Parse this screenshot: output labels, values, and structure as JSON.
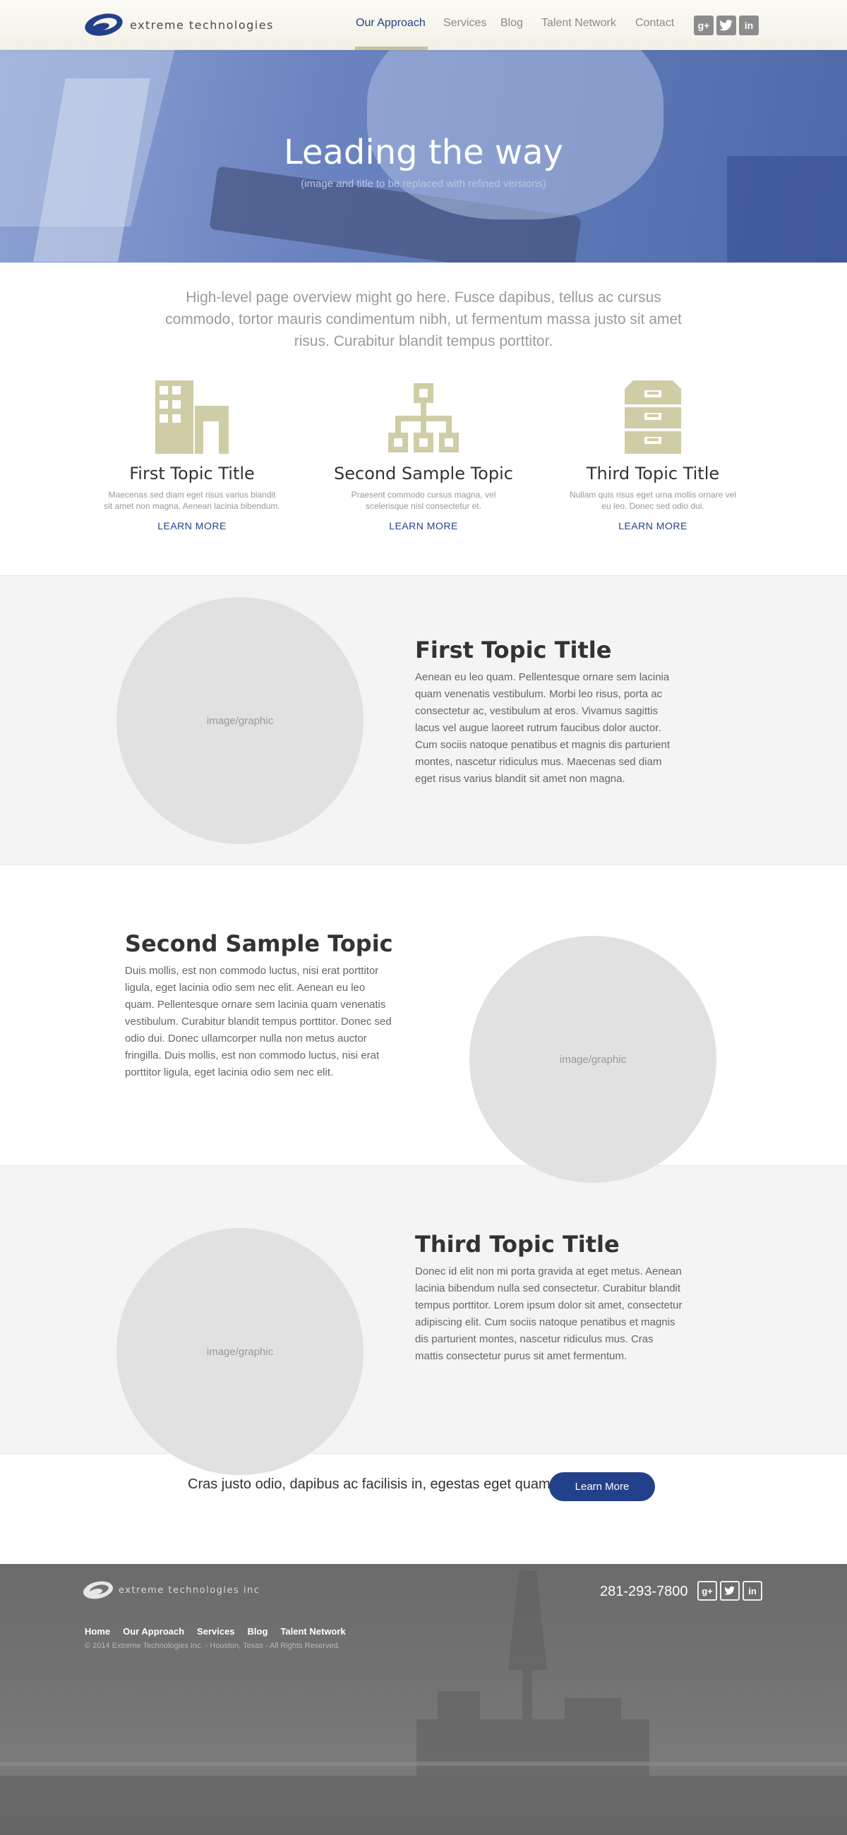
{
  "header": {
    "logo_text": "extreme technologies",
    "nav": [
      {
        "label": "Our Approach",
        "active": true
      },
      {
        "label": "Services",
        "active": false
      },
      {
        "label": "Blog",
        "active": false
      },
      {
        "label": "Talent Network",
        "active": false
      },
      {
        "label": "Contact",
        "active": false
      }
    ],
    "social": [
      {
        "icon": "google-plus-icon",
        "glyph": "g+"
      },
      {
        "icon": "twitter-icon",
        "glyph": "t"
      },
      {
        "icon": "linkedin-icon",
        "glyph": "in"
      }
    ]
  },
  "hero": {
    "title": "Leading the way",
    "subtitle": "(image and title to be replaced with refined versions)"
  },
  "overview": "High-level page overview might go here. Fusce dapibus, tellus ac cursus commodo, tortor mauris condimentum nibh, ut fermentum massa justo sit amet risus. Curabitur blandit tempus porttitor.",
  "topics": [
    {
      "icon": "building-icon",
      "title": "First Topic Title",
      "desc": "Maecenas sed diam eget risus varius blandit sit amet non magna. Aenean lacinia bibendum.",
      "link": "LEARN MORE"
    },
    {
      "icon": "org-chart-icon",
      "title": "Second Sample Topic",
      "desc": "Praesent commodo cursus magna, vel scelerisque nisl consectetur et.",
      "link": "LEARN MORE"
    },
    {
      "icon": "file-cabinet-icon",
      "title": "Third Topic Title",
      "desc": "Nullam quis risus eget urna mollis ornare vel eu leo. Donec sed odio dui.",
      "link": "LEARN MORE"
    }
  ],
  "features": [
    {
      "image_label": "image/graphic",
      "title": "First Topic Title",
      "text": "Aenean eu leo quam. Pellentesque ornare sem lacinia quam venenatis vestibulum. Morbi leo risus, porta ac consectetur ac, vestibulum at eros. Vivamus sagittis lacus vel augue laoreet rutrum faucibus dolor auctor. Cum sociis natoque penatibus et magnis dis parturient montes, nascetur ridiculus mus. Maecenas sed diam eget risus varius blandit sit amet non magna."
    },
    {
      "image_label": "image/graphic",
      "title": "Second Sample Topic",
      "text": "Duis mollis, est non commodo luctus, nisi erat porttitor ligula, eget lacinia odio sem nec elit. Aenean eu leo quam. Pellentesque ornare sem lacinia quam venenatis vestibulum. Curabitur blandit tempus porttitor. Donec sed odio dui. Donec ullamcorper nulla non metus auctor fringilla. Duis mollis, est non commodo luctus, nisi erat porttitor ligula, eget lacinia odio sem nec elit."
    },
    {
      "image_label": "image/graphic",
      "title": "Third Topic Title",
      "text": "Donec id elit non mi porta gravida at eget metus. Aenean lacinia bibendum nulla sed consectetur. Curabitur blandit tempus porttitor. Lorem ipsum dolor sit amet, consectetur adipiscing elit. Cum sociis natoque penatibus et magnis dis parturient montes, nascetur ridiculus mus. Cras mattis consectetur purus sit amet fermentum."
    }
  ],
  "cta": {
    "text": "Cras justo odio, dapibus ac facilisis in, egestas eget quam.",
    "button": "Learn More"
  },
  "footer": {
    "logo_text": "extreme technologies inc",
    "phone": "281-293-7800",
    "nav": [
      "Home",
      "Our Approach",
      "Services",
      "Blog",
      "Talent Network"
    ],
    "copyright": "© 2014 Extreme Technologies Inc. - Houston, Texas - All Rights Reserved."
  },
  "colors": {
    "brand_blue": "#23418a",
    "icon_khaki": "#cfcda6",
    "hero_blue": "#6d85c2",
    "footer_gray": "#737373"
  }
}
